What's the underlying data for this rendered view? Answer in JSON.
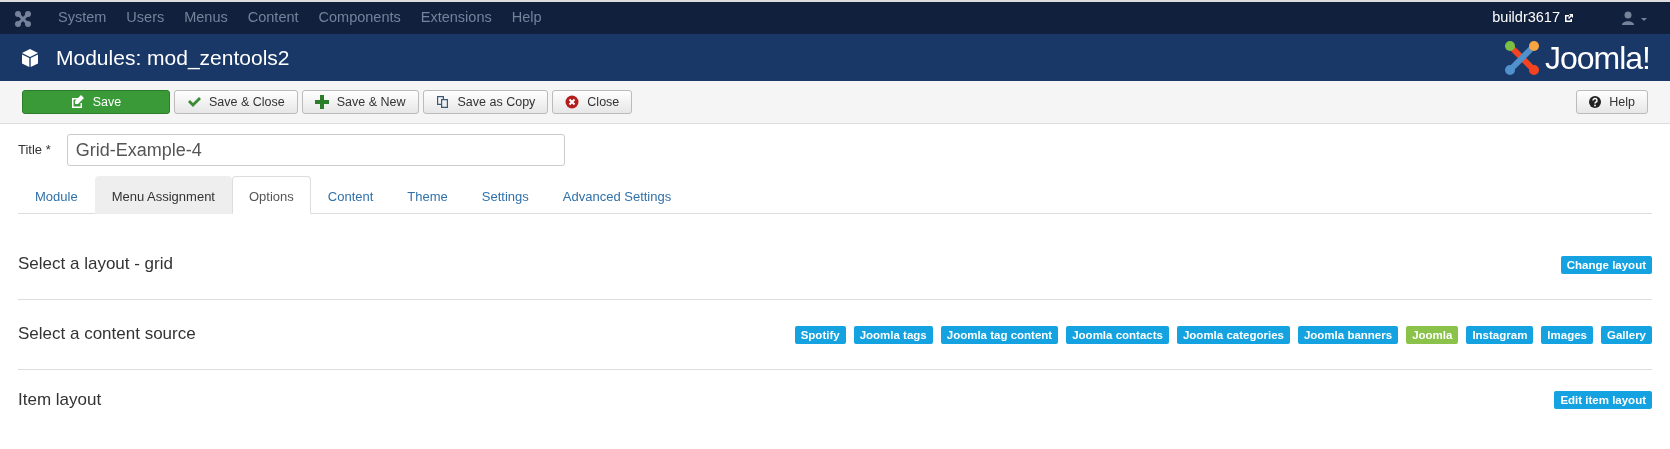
{
  "top_menu": [
    "System",
    "Users",
    "Menus",
    "Content",
    "Components",
    "Extensions",
    "Help"
  ],
  "site_link": "buildr3617",
  "header": {
    "title": "Modules: mod_zentools2",
    "logo_text": "Joomla!"
  },
  "toolbar": [
    {
      "label": "Save",
      "kind": "save"
    },
    {
      "label": "Save & Close",
      "kind": "check"
    },
    {
      "label": "Save & New",
      "kind": "plus"
    },
    {
      "label": "Save as Copy",
      "kind": "copy"
    },
    {
      "label": "Close",
      "kind": "close"
    }
  ],
  "help_button": "Help",
  "title_field": {
    "label": "Title *",
    "value": "Grid-Example-4"
  },
  "tabs": [
    {
      "label": "Module",
      "selected": false,
      "hovered": false
    },
    {
      "label": "Menu Assignment",
      "selected": false,
      "hovered": true
    },
    {
      "label": "Options",
      "selected": true,
      "hovered": false
    },
    {
      "label": "Content",
      "selected": false,
      "hovered": false
    },
    {
      "label": "Theme",
      "selected": false,
      "hovered": false
    },
    {
      "label": "Settings",
      "selected": false,
      "hovered": false
    },
    {
      "label": "Advanced Settings",
      "selected": false,
      "hovered": false
    }
  ],
  "sections": [
    {
      "heading": "Select a layout - grid",
      "buttons": [
        {
          "label": "Change layout",
          "selected": false
        }
      ]
    },
    {
      "heading": "Select a content source",
      "buttons": [
        {
          "label": "Spotify",
          "selected": false
        },
        {
          "label": "Joomla tags",
          "selected": false
        },
        {
          "label": "Joomla tag content",
          "selected": false
        },
        {
          "label": "Joomla contacts",
          "selected": false
        },
        {
          "label": "Joomla categories",
          "selected": false
        },
        {
          "label": "Joomla banners",
          "selected": false
        },
        {
          "label": "Joomla",
          "selected": true
        },
        {
          "label": "Instagram",
          "selected": false
        },
        {
          "label": "Images",
          "selected": false
        },
        {
          "label": "Gallery",
          "selected": false
        }
      ]
    },
    {
      "heading": "Item layout",
      "buttons": [
        {
          "label": "Edit item layout",
          "selected": false
        }
      ]
    }
  ]
}
